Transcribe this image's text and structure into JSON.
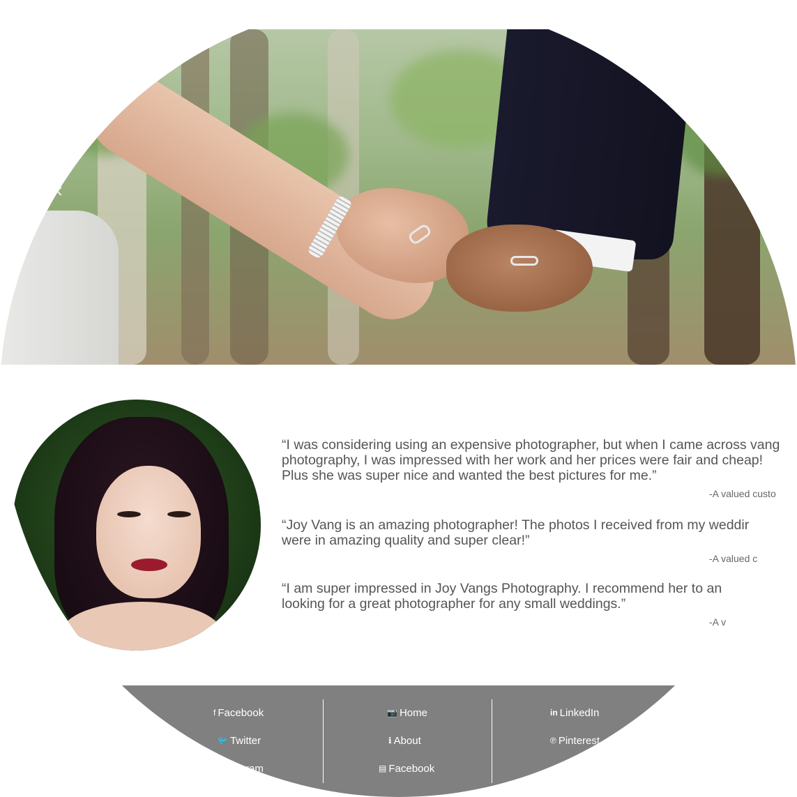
{
  "hero": {
    "prev_arrow": "‹"
  },
  "testimonials": [
    {
      "quote": "“I was considering using an expensive photographer, but when I came across vang photography, I was impressed with her work and her prices were fair and cheap! Plus she was super nice and wanted the best pictures for me.”",
      "author": "-A valued custo"
    },
    {
      "quote": "“Joy Vang is an amazing photographer! The photos I received from my weddir were in amazing quality and super clear!”",
      "author": "-A valued c"
    },
    {
      "quote": "“I am super impressed in Joy Vangs Photography. I recommend her to an looking for a great photographer for any small weddings.”",
      "author": "-A v"
    }
  ],
  "footer": {
    "social": [
      {
        "icon": "f",
        "label": "Facebook"
      },
      {
        "icon": "🐦",
        "label": "Twitter"
      },
      {
        "icon": "",
        "label": "ram"
      }
    ],
    "nav": [
      {
        "icon": "📷",
        "label": "Home"
      },
      {
        "icon": "ℹ",
        "label": "About"
      },
      {
        "icon": "▤",
        "label": "Facebook"
      }
    ],
    "more": [
      {
        "icon": "in",
        "label": "LinkedIn"
      },
      {
        "icon": "℗",
        "label": "Pinterest"
      }
    ]
  }
}
